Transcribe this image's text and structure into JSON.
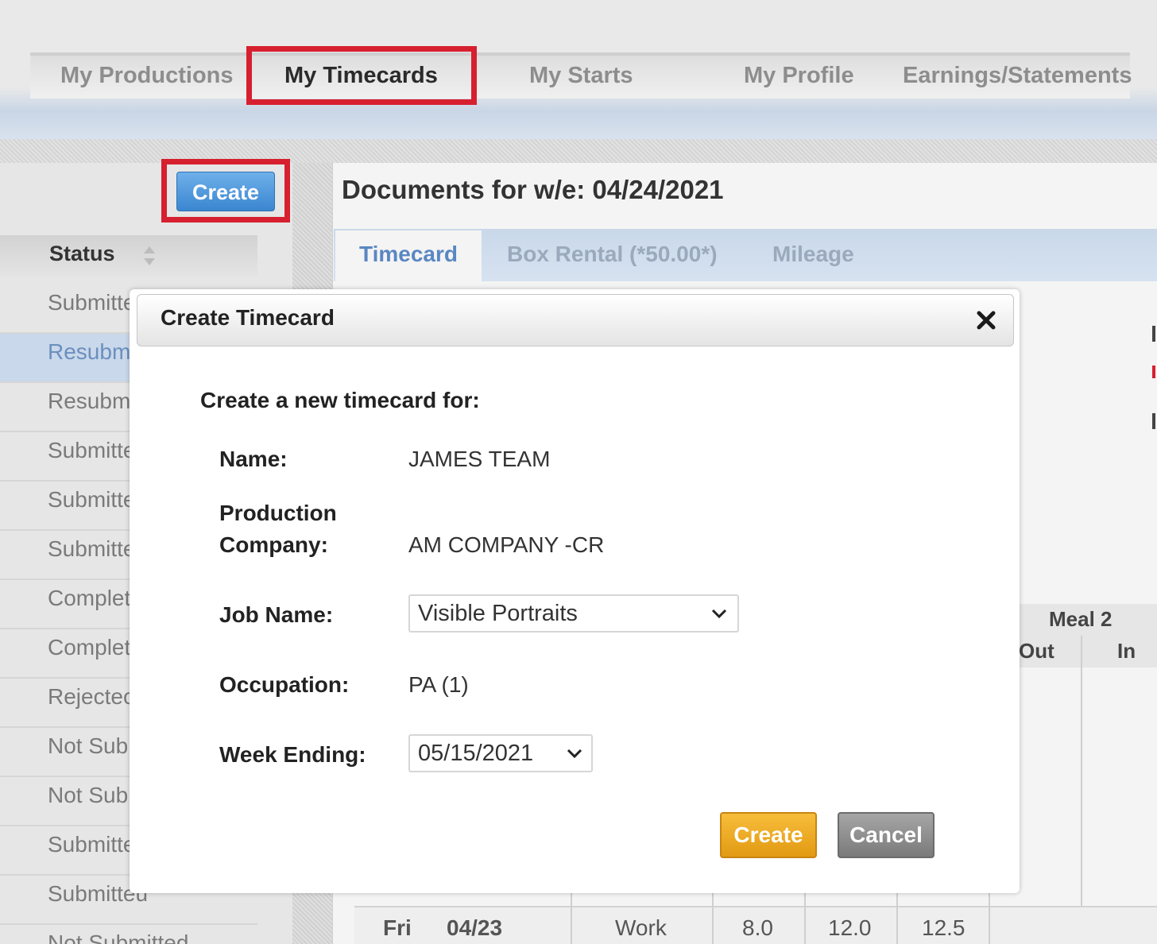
{
  "nav": {
    "tabs": [
      "My Productions",
      "My Timecards",
      "My Starts",
      "My Profile",
      "Earnings/Statements"
    ],
    "active": "My Timecards"
  },
  "sidebar": {
    "create_label": "Create",
    "status_header": "Status",
    "rows": [
      "Submitte",
      "Resubm",
      "Resubm",
      "Submitte",
      "Submitte",
      "Submitte",
      "Complet",
      "Complet",
      "Rejectec",
      "Not Sub",
      "Not Sub",
      "Submitte",
      "Submitteu",
      "Not Submitted"
    ]
  },
  "documents": {
    "title": "Documents for w/e: 04/24/2021",
    "tabs": [
      "Timecard",
      "Box Rental (*50.00*)",
      "Mileage"
    ]
  },
  "grid": {
    "meal_header": "Meal 2",
    "out_label": "Out",
    "in_label": "In",
    "bottom_row": {
      "day": "Fri",
      "date": "04/23",
      "type": "Work",
      "v1": "8.0",
      "v2": "12.0",
      "v3": "12.5"
    }
  },
  "modal": {
    "title": "Create Timecard",
    "lead": "Create a new timecard for:",
    "name_label": "Name:",
    "name_value": "JAMES TEAM",
    "company_label_1": "Production",
    "company_label_2": "Company:",
    "company_value": "AM COMPANY -CR",
    "job_label": "Job Name:",
    "job_value": "Visible Portraits",
    "occupation_label": "Occupation:",
    "occupation_value": "PA (1)",
    "week_label": "Week Ending:",
    "week_value": "05/15/2021",
    "create_label": "Create",
    "cancel_label": "Cancel"
  },
  "colors": {
    "highlight": "#d6202f",
    "create_orange": "#e29a12",
    "create_blue": "#3a86d0",
    "link_blue": "#5a87c2"
  },
  "icons": [
    "sort-icon",
    "close-icon",
    "chevron-down-icon"
  ]
}
